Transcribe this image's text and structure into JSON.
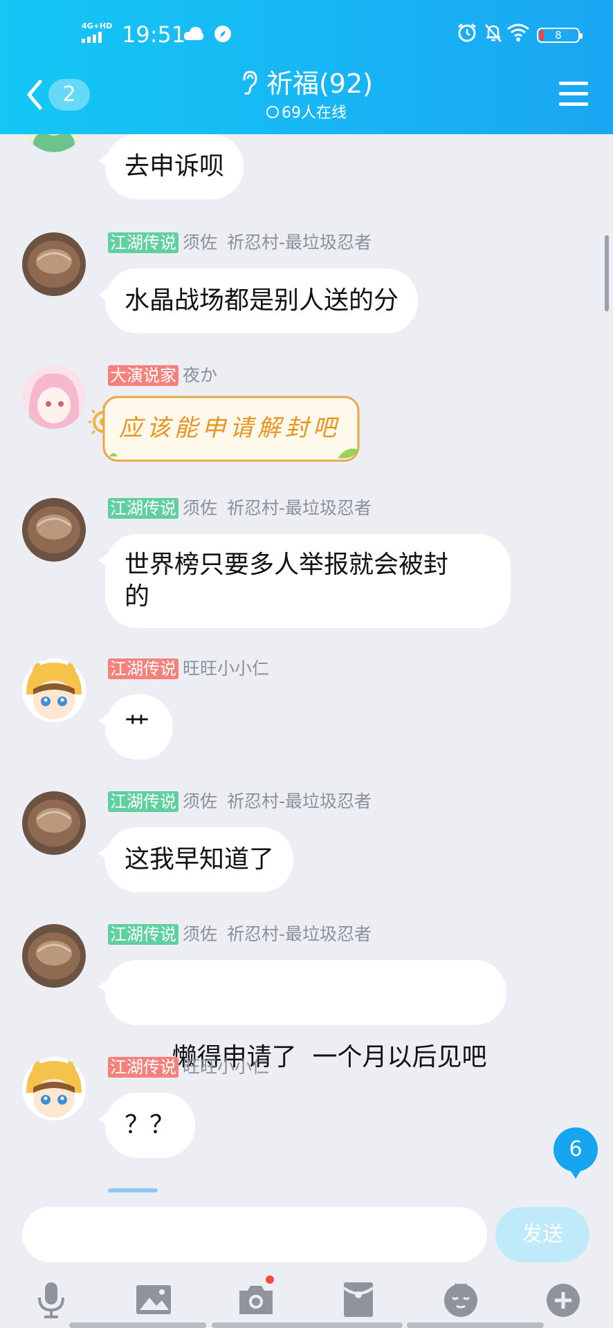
{
  "status_bar": {
    "network": "4G+HD",
    "time": "19:51",
    "battery": "8"
  },
  "header": {
    "back_badge": "2",
    "title": "祈福(92)",
    "online": "69人在线"
  },
  "messages": [
    {
      "text": "去申诉呗"
    },
    {
      "tag": "江湖传说",
      "name": "须佐",
      "title": "祈忍村-最垃圾忍者",
      "text": "水晶战场都是别人送的分"
    },
    {
      "tag": "大演说家",
      "name": "夜か",
      "sticker": "应该能申请解封吧"
    },
    {
      "tag": "江湖传说",
      "name": "须佐",
      "title": "祈忍村-最垃圾忍者",
      "text_line1": "世界榜只要多人举报就会被封",
      "text_line2": "的"
    },
    {
      "tag": "江湖传说",
      "name": "旺旺小小仁",
      "text": "艹"
    },
    {
      "tag": "江湖传说",
      "name": "须佐",
      "title": "祈忍村-最垃圾忍者",
      "text": "这我早知道了"
    },
    {
      "tag": "江湖传说",
      "name": "须佐",
      "title": "祈忍村-最垃圾忍者",
      "text": "懒得申请了  一个月以后见吧"
    },
    {
      "tag": "江湖传说",
      "name": "旺旺小小仁",
      "text": "？？"
    }
  ],
  "unread_count": "6",
  "input": {
    "value": "",
    "send_label": "发送"
  },
  "toolbar_icons": [
    "microphone-icon",
    "image-icon",
    "camera-icon",
    "red-packet-icon",
    "emoji-icon",
    "plus-icon"
  ],
  "colors": {
    "header_start": "#14c7f5",
    "header_end": "#1aa6f2",
    "tag_green": "#5fd0a0",
    "tag_red": "#f4817c",
    "send_button": "#bfeafa"
  }
}
